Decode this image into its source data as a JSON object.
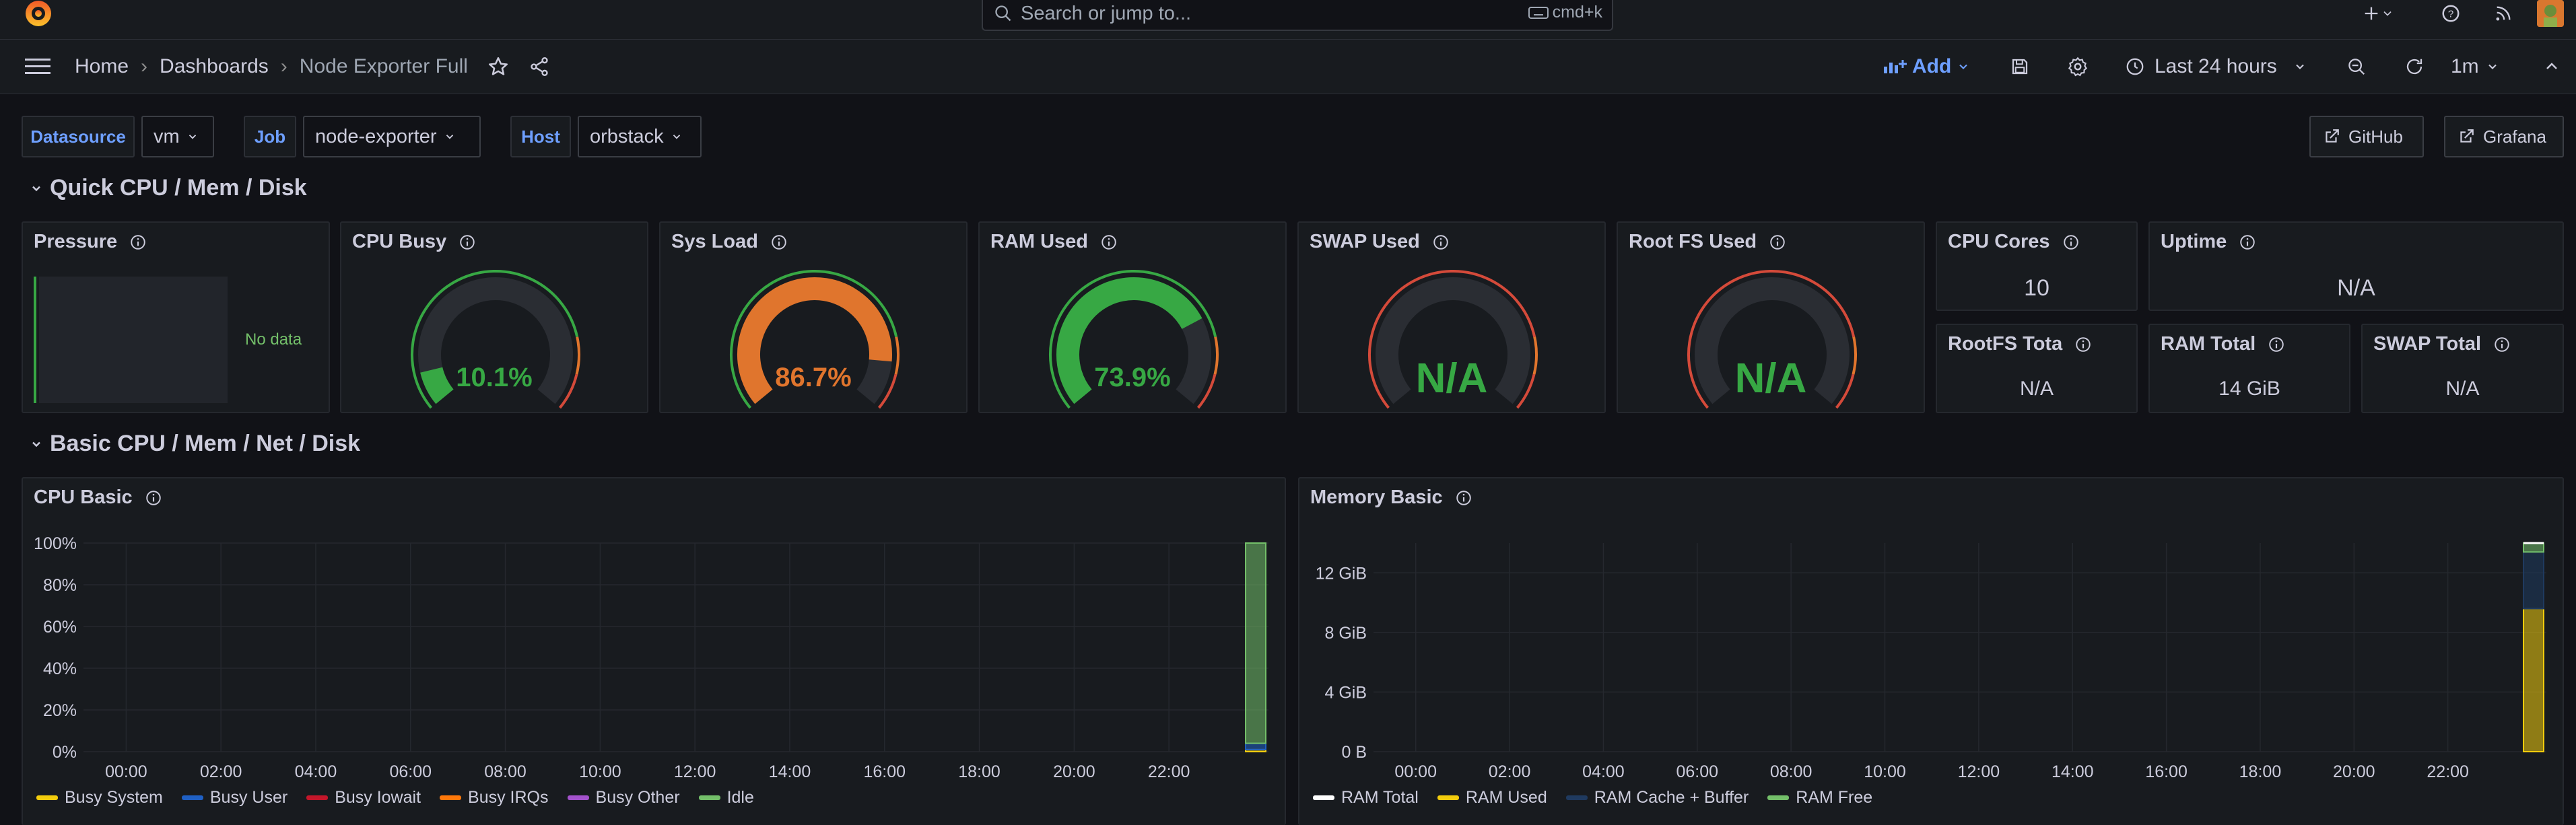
{
  "search": {
    "placeholder": "Search or jump to...",
    "shortcut": "cmd+k"
  },
  "breadcrumb": {
    "home": "Home",
    "dashboards": "Dashboards",
    "current": "Node Exporter Full"
  },
  "toolbar": {
    "add_label": "Add",
    "time_range": "Last 24 hours",
    "refresh_interval": "1m"
  },
  "variables": {
    "datasource_label": "Datasource",
    "datasource_value": "vm",
    "job_label": "Job",
    "job_value": "node-exporter",
    "host_label": "Host",
    "host_value": "orbstack"
  },
  "links": {
    "github": "GitHub",
    "grafana": "Grafana"
  },
  "rows": {
    "quick": "Quick CPU / Mem / Disk",
    "basic": "Basic CPU / Mem / Net / Disk"
  },
  "panels": {
    "pressure": {
      "title": "Pressure",
      "no_data": "No data"
    },
    "cpu_busy": {
      "title": "CPU Busy",
      "value": "10.1%",
      "fraction": 0.101
    },
    "sys_load": {
      "title": "Sys Load",
      "value": "86.7%",
      "fraction": 0.867
    },
    "ram_used": {
      "title": "RAM Used",
      "value": "73.9%",
      "fraction": 0.739
    },
    "swap_used": {
      "title": "SWAP Used",
      "value": "N/A"
    },
    "root_fs_used": {
      "title": "Root FS Used",
      "value": "N/A"
    },
    "cpu_cores": {
      "title": "CPU Cores",
      "value": "10"
    },
    "uptime": {
      "title": "Uptime",
      "value": "N/A"
    },
    "rootfs_total": {
      "title": "RootFS Tota",
      "value": "N/A"
    },
    "ram_total": {
      "title": "RAM Total",
      "value": "14 GiB"
    },
    "swap_total": {
      "title": "SWAP Total",
      "value": "N/A"
    },
    "cpu_basic": {
      "title": "CPU Basic"
    },
    "memory_basic": {
      "title": "Memory Basic"
    }
  },
  "colors": {
    "green": "#37a844",
    "orange": "#e0752d",
    "red": "#d44a3a",
    "blue": "#6e9fff",
    "yellow": "#f2cc0c"
  },
  "chart_data": [
    {
      "type": "area",
      "title": "CPU Basic",
      "x_ticks": [
        "00:00",
        "02:00",
        "04:00",
        "06:00",
        "08:00",
        "10:00",
        "12:00",
        "14:00",
        "16:00",
        "18:00",
        "20:00",
        "22:00"
      ],
      "y_ticks": [
        "0%",
        "20%",
        "40%",
        "60%",
        "80%",
        "100%"
      ],
      "ylim": [
        0,
        100
      ],
      "legend_position": "bottom",
      "series": [
        {
          "name": "Busy System",
          "color": "#f2cc0c",
          "values": [
            1
          ]
        },
        {
          "name": "Busy User",
          "color": "#1f60c4",
          "values": [
            3
          ]
        },
        {
          "name": "Busy Iowait",
          "color": "#c4162a",
          "values": [
            0
          ]
        },
        {
          "name": "Busy IRQs",
          "color": "#ff780a",
          "values": [
            0
          ]
        },
        {
          "name": "Busy Other",
          "color": "#a352cc",
          "values": [
            0
          ]
        },
        {
          "name": "Idle",
          "color": "#73bf69",
          "values": [
            96
          ]
        }
      ]
    },
    {
      "type": "area",
      "title": "Memory Basic",
      "x_ticks": [
        "00:00",
        "02:00",
        "04:00",
        "06:00",
        "08:00",
        "10:00",
        "12:00",
        "14:00",
        "16:00",
        "18:00",
        "20:00",
        "22:00"
      ],
      "y_ticks": [
        "0 B",
        "4 GiB",
        "8 GiB",
        "12 GiB"
      ],
      "ylim": [
        0,
        14
      ],
      "legend_position": "bottom",
      "series": [
        {
          "name": "RAM Total",
          "color": "#ffffff",
          "values": [
            14
          ]
        },
        {
          "name": "RAM Used",
          "color": "#f2cc0c",
          "values": [
            9.6
          ]
        },
        {
          "name": "RAM Cache + Buffer",
          "color": "#1f3a5f",
          "values": [
            3.8
          ]
        },
        {
          "name": "RAM Free",
          "color": "#73bf69",
          "values": [
            0.6
          ]
        }
      ]
    }
  ]
}
